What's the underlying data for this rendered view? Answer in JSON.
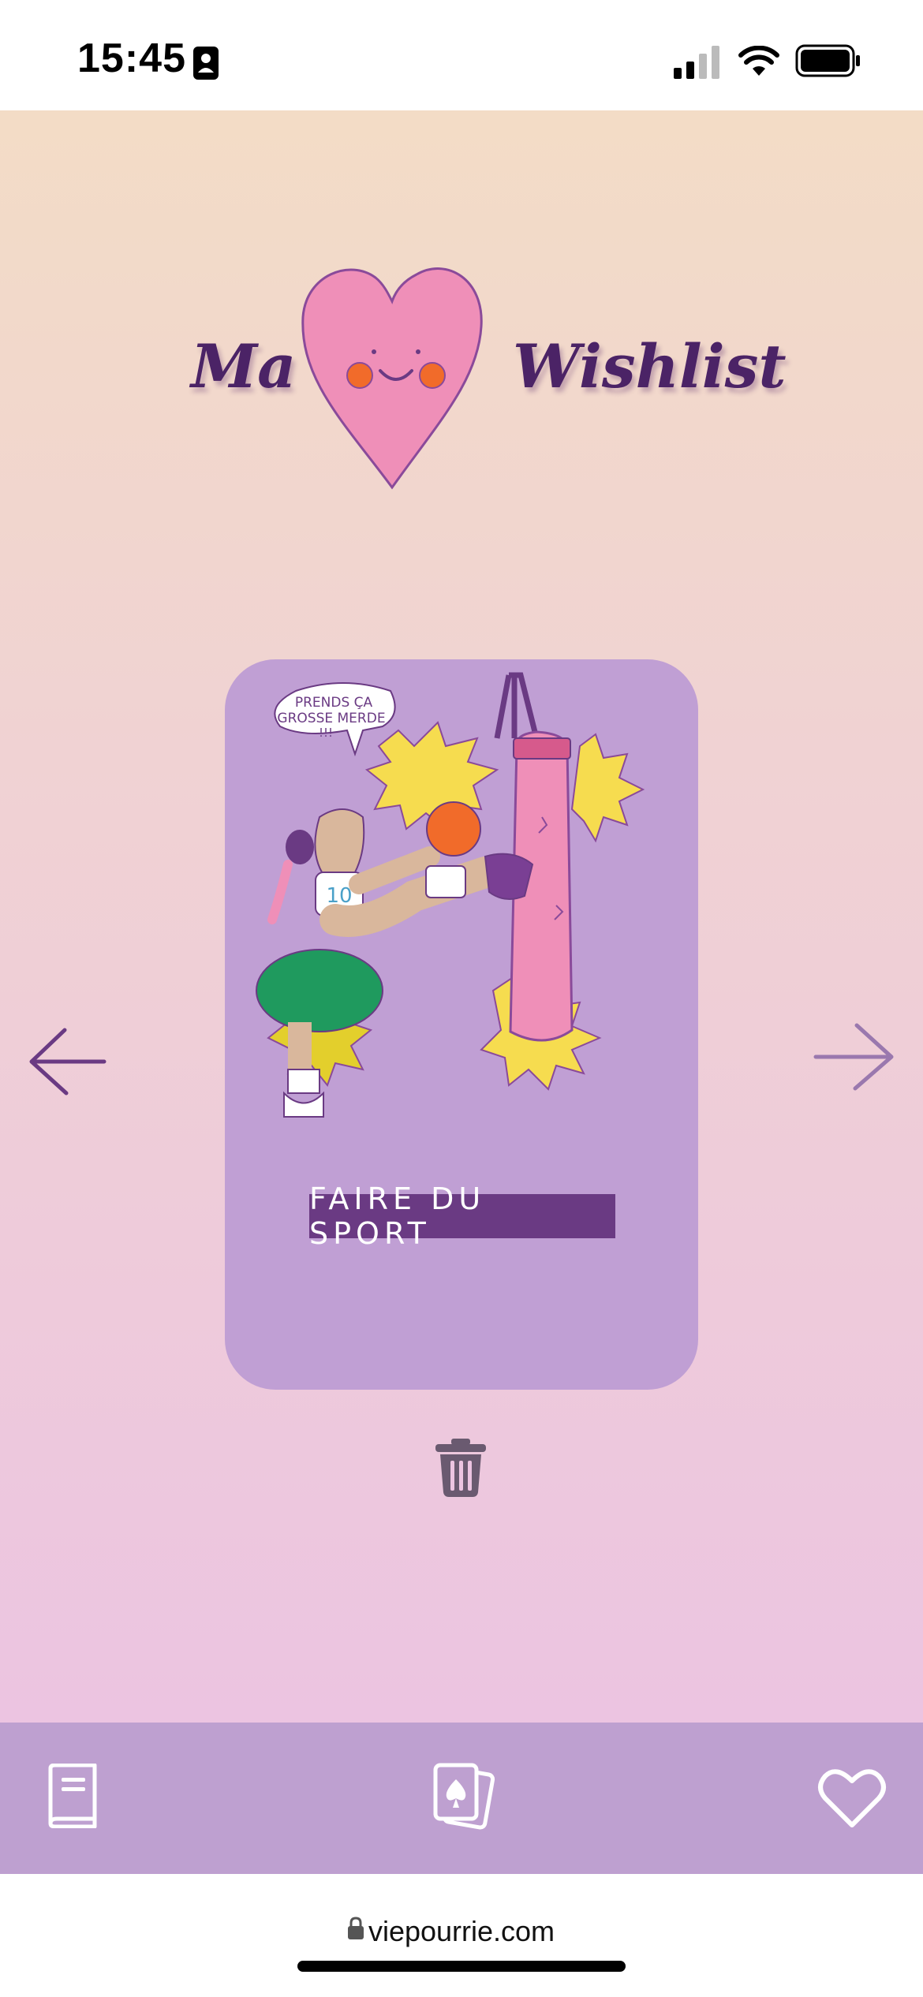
{
  "status_bar": {
    "time": "15:45"
  },
  "header": {
    "title_left": "Ma",
    "title_right": "Wishlist"
  },
  "card": {
    "speech": [
      "PRENDS ÇA",
      "GROSSE MERDE",
      "!!!"
    ],
    "jersey_number": "10",
    "label": "FAIRE DU SPORT"
  },
  "tabbar": {
    "items": [
      "book-icon",
      "cards-icon",
      "heart-icon"
    ]
  },
  "browser": {
    "url": "viepourrie.com"
  },
  "colors": {
    "accent": "#4b2366",
    "card": "#c09fd4",
    "tabbar": "#bea0d0",
    "label_bg": "#6a3a83"
  }
}
